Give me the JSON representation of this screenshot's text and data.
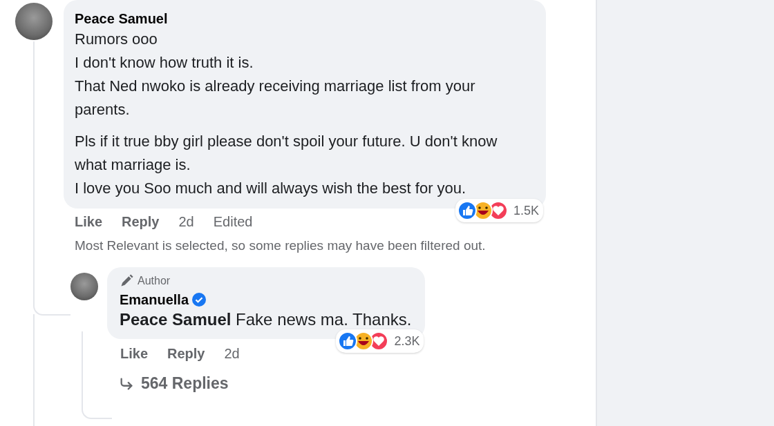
{
  "comment": {
    "author": "Peace Samuel",
    "paragraphs": [
      [
        "Rumors ooo",
        "I don't know how truth it is.",
        "That Ned nwoko is already receiving marriage list from your parents."
      ],
      [
        "Pls if it true bby girl please don't spoil your future. U don't know what marriage is.",
        "I love you Soo much and will always wish the best for you."
      ]
    ],
    "reactions": {
      "count": "1.5K"
    },
    "actions": [
      {
        "label": "Like",
        "kind": "link"
      },
      {
        "label": "Reply",
        "kind": "link"
      },
      {
        "label": "2d",
        "kind": "meta"
      },
      {
        "label": "Edited",
        "kind": "meta"
      }
    ]
  },
  "filter_note": "Most Relevant is selected, so some replies may have been filtered out.",
  "reply": {
    "badge": "Author",
    "author": "Emanuella",
    "verified": true,
    "mention": "Peace Samuel",
    "text": "Fake news ma. Thanks.",
    "reactions": {
      "count": "2.3K"
    },
    "actions": [
      {
        "label": "Like",
        "kind": "link"
      },
      {
        "label": "Reply",
        "kind": "link"
      },
      {
        "label": "2d",
        "kind": "meta"
      }
    ],
    "replies_link": "564 Replies"
  }
}
